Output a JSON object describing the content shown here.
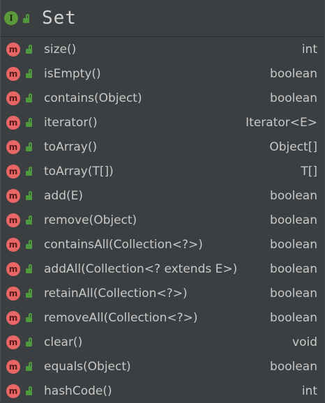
{
  "header": {
    "badge": "I",
    "title": "Set"
  },
  "methods": [
    {
      "badge": "m",
      "signature": "size()",
      "return_type": "int"
    },
    {
      "badge": "m",
      "signature": "isEmpty()",
      "return_type": "boolean"
    },
    {
      "badge": "m",
      "signature": "contains(Object)",
      "return_type": "boolean"
    },
    {
      "badge": "m",
      "signature": "iterator()",
      "return_type": "Iterator<E>"
    },
    {
      "badge": "m",
      "signature": "toArray()",
      "return_type": "Object[]"
    },
    {
      "badge": "m",
      "signature": "toArray(T[])",
      "return_type": "T[]"
    },
    {
      "badge": "m",
      "signature": "add(E)",
      "return_type": "boolean"
    },
    {
      "badge": "m",
      "signature": "remove(Object)",
      "return_type": "boolean"
    },
    {
      "badge": "m",
      "signature": "containsAll(Collection<?>)",
      "return_type": "boolean"
    },
    {
      "badge": "m",
      "signature": "addAll(Collection<? extends E>)",
      "return_type": "boolean"
    },
    {
      "badge": "m",
      "signature": "retainAll(Collection<?>)",
      "return_type": "boolean"
    },
    {
      "badge": "m",
      "signature": "removeAll(Collection<?>)",
      "return_type": "boolean"
    },
    {
      "badge": "m",
      "signature": "clear()",
      "return_type": "void"
    },
    {
      "badge": "m",
      "signature": "equals(Object)",
      "return_type": "boolean"
    },
    {
      "badge": "m",
      "signature": "hashCode()",
      "return_type": "int"
    }
  ],
  "icons": {
    "interface": "interface-icon",
    "method": "method-icon",
    "visibility": "public-lock-icon"
  },
  "colors": {
    "background": "#3c3f41",
    "interface_badge": "#5c9a3a",
    "method_badge": "#e86666",
    "lock": "#4f9a3f",
    "text": "#c8c8c8"
  }
}
